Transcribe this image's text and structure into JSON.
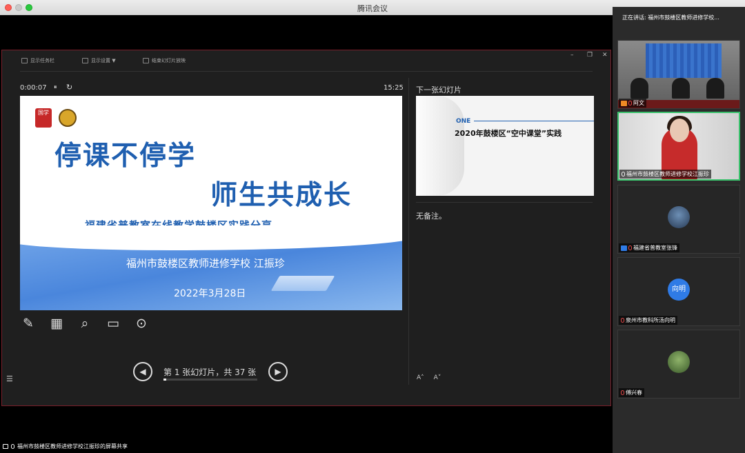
{
  "app": {
    "title": "腾讯会议"
  },
  "presenter_view": {
    "toolbar": {
      "show_taskbar": "显示任务栏",
      "display_settings": "显示设置 ▼",
      "end_show": "结束幻灯片放映"
    },
    "timer": "0:00:07",
    "pause_icon": "⏸",
    "restart_icon": "↻",
    "clock": "15:25",
    "current_slide": {
      "seal_text": "国学",
      "title_line1": "停课不停学",
      "title_line2": "师生共成长",
      "subtitle": "——福建省普教室在线教学鼓楼区实践分享",
      "presenter": "福州市鼓楼区教师进修学校 江振珍",
      "date": "2022年3月28日"
    },
    "tools": [
      "pen-icon",
      "slides-grid-icon",
      "zoom-icon",
      "screen-icon",
      "more-icon"
    ],
    "navigation": {
      "prev": "◀",
      "next": "▶",
      "status": "第 1 张幻灯片，共 37 张",
      "progress": 0.027
    },
    "next_label": "下一张幻灯片",
    "next_slide": {
      "section": "ONE",
      "title": "2020年鼓楼区“空中课堂”实践"
    },
    "notes": "无备注。",
    "font_increase": "A˄",
    "font_decrease": "A˅"
  },
  "share_caption": "福州市鼓楼区教师进修学校江振珍的屏幕共享",
  "sidebar": {
    "speaking": "正在讲话: 福州市鼓楼区教师进修学校...",
    "participants": [
      {
        "name": "阿文"
      },
      {
        "name": "福州市鼓楼区教师进修学校江振珍"
      },
      {
        "name": "福建省普教室张锋"
      },
      {
        "name": "泉州市教科所汤向明",
        "avatar_text": "向明"
      },
      {
        "name": "傅兴春"
      }
    ]
  },
  "colors": {
    "accent": "#1f5fb0",
    "active_border": "#39c06b",
    "window_border": "#7a1f2a"
  }
}
